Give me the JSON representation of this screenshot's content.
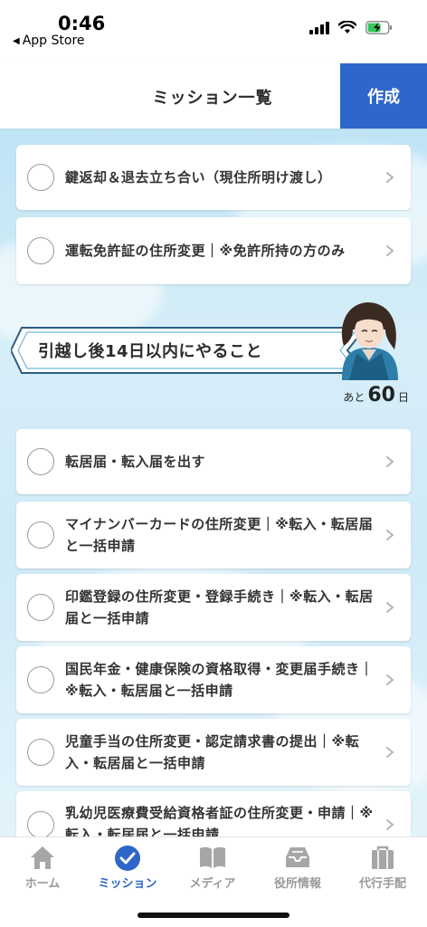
{
  "status": {
    "time": "0:46",
    "back_app": "App Store"
  },
  "header": {
    "title": "ミッション一覧",
    "create_label": "作成"
  },
  "missions_top": [
    {
      "label": "鍵返却＆退去立ち合い（現住所明け渡し）"
    },
    {
      "label": "運転免許証の住所変更｜※免許所持の方のみ"
    }
  ],
  "section": {
    "title": "引越し後14日以内にやること",
    "remaining_prefix": "あと",
    "remaining_value": "60",
    "remaining_suffix": "日"
  },
  "missions_after": [
    {
      "label": "転居届・転入届を出す"
    },
    {
      "label": "マイナンバーカードの住所変更｜※転入・転居届と一括申請"
    },
    {
      "label": "印鑑登録の住所変更・登録手続き｜※転入・転居届と一括申請"
    },
    {
      "label": "国民年金・健康保険の資格取得・変更届手続き｜※転入・転居届と一括申請"
    },
    {
      "label": "児童手当の住所変更・認定請求書の提出｜※転入・転居届と一括申請"
    },
    {
      "label": "乳幼児医療費受給資格者証の住所変更・申請｜※転入・転居届と一括申請"
    }
  ],
  "tabs": [
    {
      "label": "ホーム",
      "icon": "home-icon"
    },
    {
      "label": "ミッション",
      "icon": "check-circle-icon",
      "active": true
    },
    {
      "label": "メディア",
      "icon": "book-icon"
    },
    {
      "label": "役所情報",
      "icon": "inbox-icon"
    },
    {
      "label": "代行手配",
      "icon": "suitcase-icon"
    }
  ],
  "colors": {
    "accent": "#2f66c9",
    "inactive": "#9a9a9a",
    "background_sky": "#cfeaf7"
  }
}
